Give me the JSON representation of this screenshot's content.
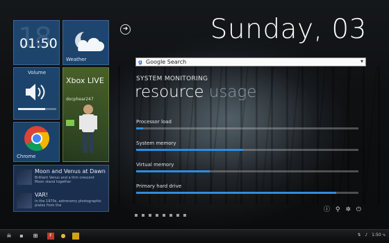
{
  "tiles": {
    "clock": {
      "big": "18",
      "time": "01:50"
    },
    "weather": {
      "label": "Weather"
    },
    "volume": {
      "label": "Volume",
      "level": 0.7
    },
    "xbox": {
      "title": "Xbox LIVE",
      "gamertag": "docphear247"
    },
    "chrome": {
      "label": "Chrome"
    },
    "news": [
      {
        "title": "Moon and Venus at Dawn",
        "desc": "Brilliant Venus and a thin crescent Moon stand together"
      },
      {
        "title": "VAR!",
        "desc": "In the 1970s, astronomy photographic plates from the"
      }
    ]
  },
  "header": {
    "back_icon": "arrow-right-circle",
    "date": "Sunday, 03"
  },
  "search": {
    "brand": "g",
    "label": "Google Search"
  },
  "monitor": {
    "section": "SYSTEM MONITORING",
    "title_primary": "resource",
    "title_secondary": "usage",
    "resources": [
      {
        "label": "Processor load",
        "value": 0.03
      },
      {
        "label": "System memory",
        "value": 0.48
      },
      {
        "label": "Virtual memory",
        "value": 0.33
      },
      {
        "label": "Primary hard drive",
        "value": 0.9
      }
    ],
    "accent": "#2f8de0"
  },
  "pager": {
    "count": 8
  },
  "system_icons": [
    "info-icon",
    "settings-icon",
    "brightness-icon",
    "power-icon"
  ],
  "taskbar": {
    "tray_time": "1:50 ч."
  }
}
